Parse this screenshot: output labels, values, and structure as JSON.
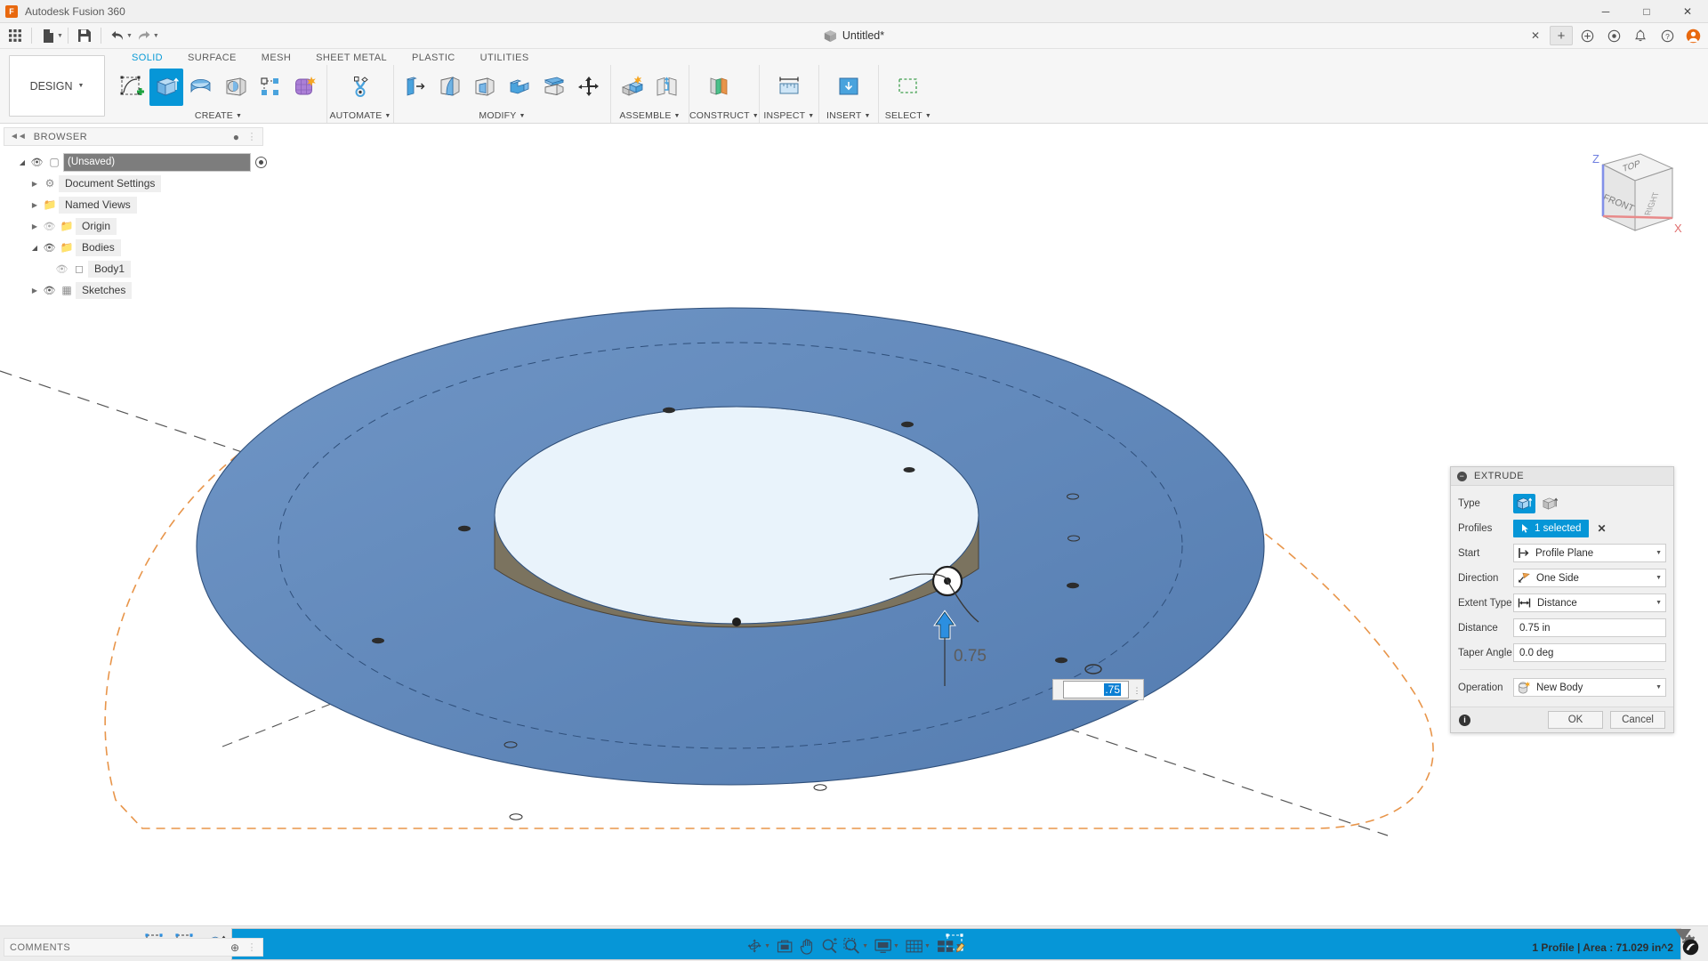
{
  "window": {
    "title": "Autodesk Fusion 360",
    "logo_text": "F",
    "controls": {
      "minimize": "─",
      "maximize": "□",
      "close": "✕"
    }
  },
  "quick_access": {
    "grid_icon": "grid-icon",
    "new_icon": "new-document-icon",
    "save_icon": "save-icon",
    "undo_icon": "undo-icon",
    "redo_icon": "redo-icon",
    "document_tab": "Untitled*",
    "right_icons": [
      "close-tab-icon",
      "add-tab-icon",
      "help-circle-icon",
      "extensions-icon",
      "notifications-icon",
      "bell-icon",
      "help-icon",
      "account-icon"
    ]
  },
  "ribbon": {
    "workspace": "DESIGN",
    "tabs": [
      {
        "label": "SOLID",
        "active": true
      },
      {
        "label": "SURFACE",
        "active": false
      },
      {
        "label": "MESH",
        "active": false
      },
      {
        "label": "SHEET METAL",
        "active": false
      },
      {
        "label": "PLASTIC",
        "active": false
      },
      {
        "label": "UTILITIES",
        "active": false
      }
    ],
    "panels": [
      {
        "label": "CREATE",
        "tools": [
          {
            "name": "create-sketch-icon",
            "active": false
          },
          {
            "name": "extrude-icon",
            "active": true
          },
          {
            "name": "revolve-icon",
            "active": false
          },
          {
            "name": "sweep-icon",
            "active": false
          },
          {
            "name": "pattern-icon",
            "active": false
          },
          {
            "name": "create-form-icon",
            "active": false
          }
        ]
      },
      {
        "label": "AUTOMATE",
        "tools": [
          {
            "name": "automate-topology-icon",
            "active": false
          }
        ]
      },
      {
        "label": "MODIFY",
        "tools": [
          {
            "name": "press-pull-icon",
            "active": false
          },
          {
            "name": "fillet-icon",
            "active": false
          },
          {
            "name": "shell-icon",
            "active": false
          },
          {
            "name": "combine-icon",
            "active": false
          },
          {
            "name": "split-face-icon",
            "active": false
          },
          {
            "name": "move-copy-icon",
            "active": false
          }
        ]
      },
      {
        "label": "ASSEMBLE",
        "tools": [
          {
            "name": "new-component-icon",
            "active": false
          },
          {
            "name": "joint-icon",
            "active": false
          }
        ]
      },
      {
        "label": "CONSTRUCT",
        "tools": [
          {
            "name": "offset-plane-icon",
            "active": false
          }
        ]
      },
      {
        "label": "INSPECT",
        "tools": [
          {
            "name": "measure-icon",
            "active": false
          }
        ]
      },
      {
        "label": "INSERT",
        "tools": [
          {
            "name": "insert-derive-icon",
            "active": false
          }
        ]
      },
      {
        "label": "SELECT",
        "tools": [
          {
            "name": "select-window-icon",
            "active": false
          }
        ]
      }
    ]
  },
  "browser": {
    "title": "BROWSER",
    "nodes": [
      {
        "label": "(Unsaved)",
        "indent": 0,
        "arrow": "open",
        "eye": "on",
        "icon": "document-cube-icon",
        "selected": true,
        "radio": true
      },
      {
        "label": "Document Settings",
        "indent": 1,
        "arrow": "closed",
        "eye": "none",
        "icon": "gear-icon",
        "selected": false,
        "radio": false
      },
      {
        "label": "Named Views",
        "indent": 1,
        "arrow": "closed",
        "eye": "none",
        "icon": "folder-icon",
        "selected": false,
        "radio": false
      },
      {
        "label": "Origin",
        "indent": 1,
        "arrow": "closed",
        "eye": "off",
        "icon": "folder-icon",
        "selected": false,
        "radio": false
      },
      {
        "label": "Bodies",
        "indent": 1,
        "arrow": "open",
        "eye": "on",
        "icon": "folder-icon",
        "selected": false,
        "radio": false
      },
      {
        "label": "Body1",
        "indent": 2,
        "arrow": "none",
        "eye": "off",
        "icon": "body-icon",
        "selected": false,
        "radio": false
      },
      {
        "label": "Sketches",
        "indent": 1,
        "arrow": "closed",
        "eye": "on",
        "icon": "sketches-icon",
        "selected": false,
        "radio": false
      }
    ]
  },
  "viewcube": {
    "faces": {
      "top": "TOP",
      "front": "FRONT",
      "right": "RIGHT"
    },
    "axes": {
      "z": "Z",
      "x": "X"
    }
  },
  "dialog": {
    "title": "EXTRUDE",
    "rows": {
      "type_label": "Type",
      "type_options": [
        "extrude-profile-icon",
        "extrude-thin-icon"
      ],
      "profiles_label": "Profiles",
      "profiles_value": "1 selected",
      "profiles_clear": "✕",
      "start_label": "Start",
      "start_value": "Profile Plane",
      "direction_label": "Direction",
      "direction_value": "One Side",
      "extent_label": "Extent Type",
      "extent_value": "Distance",
      "distance_label": "Distance",
      "distance_value": "0.75 in",
      "taper_label": "Taper Angle",
      "taper_value": "0.0 deg",
      "operation_label": "Operation",
      "operation_value": "New Body"
    },
    "footer": {
      "ok": "OK",
      "cancel": "Cancel",
      "info": "i"
    }
  },
  "canvas": {
    "dimension_label": "0.75",
    "input_value": ".75"
  },
  "comments": {
    "title": "COMMENTS",
    "add": "⊕"
  },
  "navbar": {
    "items": [
      {
        "name": "orbit-icon",
        "caret": true
      },
      {
        "name": "look-at-icon",
        "caret": false
      },
      {
        "name": "pan-icon",
        "caret": false
      },
      {
        "name": "zoom-icon",
        "caret": false
      },
      {
        "name": "zoom-window-icon",
        "caret": true
      },
      {
        "name": "display-settings-icon",
        "caret": true
      },
      {
        "name": "grid-snaps-icon",
        "caret": true
      },
      {
        "name": "viewports-icon",
        "caret": true
      }
    ]
  },
  "status_bar": {
    "text": "1 Profile | Area : 71.029 in^2",
    "icon": "fusion-badge-icon"
  },
  "timeline": {
    "buttons": [
      "skip-start-icon",
      "step-back-icon",
      "play-icon",
      "step-forward-icon",
      "skip-end-icon"
    ],
    "features": [
      {
        "name": "sketch-feature-icon",
        "selected": false
      },
      {
        "name": "sketch-feature-icon",
        "selected": false
      },
      {
        "name": "extrude-feature-icon",
        "selected": false
      },
      {
        "name": "extrude-sketch-feature-icon",
        "selected": true
      }
    ],
    "settings_icon": "settings-gear-icon"
  },
  "colors": {
    "accent": "#0696d7",
    "brand_orange": "#e8680e",
    "body_blue": "#5b7fae",
    "body_top_tan": "#8a8070",
    "sketch_orange": "#e8954a",
    "panel_bg": "#f6f6f6"
  }
}
